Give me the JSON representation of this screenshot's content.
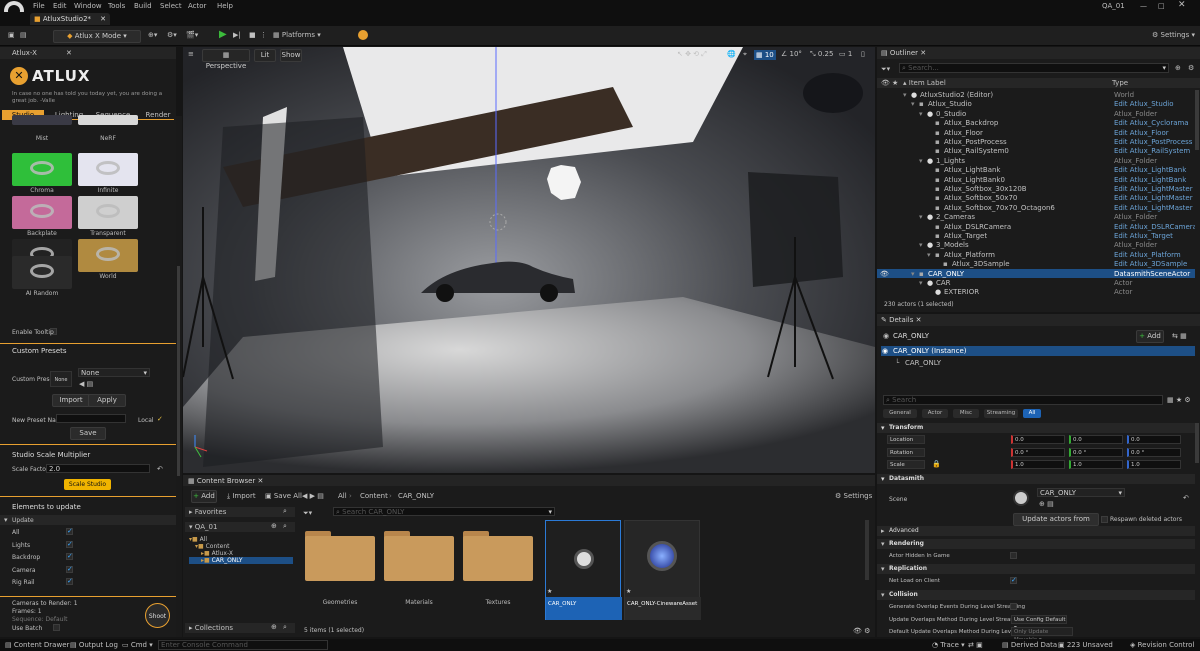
{
  "menu": [
    "File",
    "Edit",
    "Window",
    "Tools",
    "Build",
    "Select",
    "Actor",
    "Help"
  ],
  "project": "QA_01",
  "doc_tab": "AtluxStudio2*",
  "toolbar": {
    "mode": "Atlux X Mode",
    "platforms": "Platforms",
    "settings": "Settings"
  },
  "viewport": {
    "perspective": "Perspective",
    "lit": "Lit",
    "show": "Show",
    "grid": "10",
    "angle": "10°",
    "scale": "0.25",
    "cam": "1"
  },
  "left": {
    "tab": "Atlux-X",
    "logo": "ATLUX",
    "tagline": "In case no one has told you today yet, you are doing a great job. -Valle",
    "tabs": [
      "Studio",
      "Lighting",
      "Sequence",
      "Render"
    ],
    "thumbs": [
      {
        "label": "Mist",
        "color": "#3a3a45"
      },
      {
        "label": "NeRF",
        "color": "#d8d8d8"
      },
      {
        "label": "Chroma",
        "color": "#2fbf3a"
      },
      {
        "label": "Infinite",
        "color": "#e4e4ef"
      },
      {
        "label": "Backplate",
        "color": "#c46a9a"
      },
      {
        "label": "Transparent",
        "color": "#cfcfcf"
      },
      {
        "label": "MetaPortrait",
        "color": "#222"
      },
      {
        "label": "World",
        "color": "#b08a40"
      },
      {
        "label": "AI Random",
        "color": "#2a2a2a"
      }
    ],
    "enable_tooltip": "Enable Tooltip",
    "custom_presets": "Custom Presets",
    "custom_preset": "Custom Preset",
    "none": "None",
    "none2": "None",
    "import": "Import",
    "apply": "Apply",
    "new_preset_name": "New Preset Name",
    "local": "Local",
    "save": "Save",
    "scale_mult": "Studio Scale Multiplier",
    "scale_factor": "Scale Factor",
    "scale_val": "2.0",
    "scale_studio": "Scale Studio",
    "elements": "Elements to update",
    "update": "Update",
    "update_items": [
      "All",
      "Lights",
      "Backdrop",
      "Camera",
      "Rig Rail"
    ],
    "cameras": "Cameras to Render: 1",
    "frames": "Frames: 1",
    "sequence": "Sequence: Default",
    "use_batch": "Use Batch",
    "shoot": "Shoot"
  },
  "outliner": {
    "title": "Outliner",
    "search": "Search...",
    "col_label": "Item Label",
    "col_type": "Type",
    "count": "230 actors (1 selected)",
    "rows": [
      {
        "n": "AtluxStudio2 (Editor)",
        "t": "World",
        "d": 0,
        "g": 1
      },
      {
        "n": "Atlux_Studio",
        "t": "Edit Atlux_Studio",
        "d": 1,
        "g": 0
      },
      {
        "n": "0_Studio",
        "t": "Atlux_Folder",
        "d": 2,
        "g": 1
      },
      {
        "n": "Atlux_Backdrop",
        "t": "Edit Atlux_Cyclorama",
        "d": 3,
        "g": 0
      },
      {
        "n": "Atlux_Floor",
        "t": "Edit Atlux_Floor",
        "d": 3,
        "g": 0
      },
      {
        "n": "Atlux_PostProcess",
        "t": "Edit Atlux_PostProcess",
        "d": 3,
        "g": 0
      },
      {
        "n": "Atlux_RailSystem0",
        "t": "Edit Atlux_RailSystem",
        "d": 3,
        "g": 0
      },
      {
        "n": "1_Lights",
        "t": "Atlux_Folder",
        "d": 2,
        "g": 1
      },
      {
        "n": "Atlux_LightBank",
        "t": "Edit Atlux_LightBank",
        "d": 3,
        "g": 0
      },
      {
        "n": "Atlux_LightBank0",
        "t": "Edit Atlux_LightBank",
        "d": 3,
        "g": 0
      },
      {
        "n": "Atlux_Softbox_30x120B",
        "t": "Edit Atlux_LightMaster",
        "d": 3,
        "g": 0
      },
      {
        "n": "Atlux_Softbox_50x70",
        "t": "Edit Atlux_LightMaster",
        "d": 3,
        "g": 0
      },
      {
        "n": "Atlux_Softbox_70x70_Octagon6",
        "t": "Edit Atlux_LightMaster",
        "d": 3,
        "g": 0
      },
      {
        "n": "2_Cameras",
        "t": "Atlux_Folder",
        "d": 2,
        "g": 1
      },
      {
        "n": "Atlux_DSLRCamera",
        "t": "Edit Atlux_DSLRCamera",
        "d": 3,
        "g": 0
      },
      {
        "n": "Atlux_Target",
        "t": "Edit Atlux_Target",
        "d": 3,
        "g": 0
      },
      {
        "n": "3_Models",
        "t": "Atlux_Folder",
        "d": 2,
        "g": 1
      },
      {
        "n": "Atlux_Platform",
        "t": "Edit Atlux_Platform",
        "d": 3,
        "g": 0
      },
      {
        "n": "Atlux_3DSample",
        "t": "Edit Atlux_3DSample",
        "d": 4,
        "g": 0
      },
      {
        "n": "CAR_ONLY",
        "t": "DatasmithSceneActor",
        "d": 1,
        "g": 0,
        "sel": 1
      },
      {
        "n": "CAR",
        "t": "Actor",
        "d": 2,
        "g": 1
      },
      {
        "n": "EXTERIOR",
        "t": "Actor",
        "d": 3,
        "g": 1
      }
    ]
  },
  "details": {
    "title": "Details",
    "actor": "CAR_ONLY",
    "add": "Add",
    "instance": "CAR_ONLY (Instance)",
    "child": "CAR_ONLY",
    "search": "Search",
    "filters": [
      "General",
      "Actor",
      "Misc",
      "Streaming",
      "All"
    ],
    "transform": "Transform",
    "location": "Location",
    "rotation": "Rotation",
    "scale": "Scale",
    "loc": [
      "0.0",
      "0.0",
      "0.0"
    ],
    "rot": [
      "0.0 °",
      "0.0 °",
      "0.0 °"
    ],
    "scl": [
      "1.0",
      "1.0",
      "1.0"
    ],
    "datasmith": "Datasmith",
    "scene": "Scene",
    "scene_val": "CAR_ONLY",
    "update_actors": "Update actors from Scene",
    "respawn": "Respawn deleted actors",
    "advanced": "Advanced",
    "rendering": "Rendering",
    "hidden": "Actor Hidden In Game",
    "replication": "Replication",
    "netload": "Net Load on Client",
    "collision": "Collision",
    "gen_overlap": "Generate Overlap Events During Level Streaming",
    "upd_overlap": "Update Overlaps Method During Level Streaming",
    "upd_val": "Use Config Default",
    "def_overlap": "Default Update Overlaps Method During Level Str...",
    "def_val": "Only Update Movable"
  },
  "content": {
    "title": "Content Browser",
    "add": "Add",
    "import": "Import",
    "saveall": "Save All",
    "path": [
      "All",
      "Content",
      "CAR_ONLY"
    ],
    "settings": "Settings",
    "favorites": "Favorites",
    "project": "QA_01",
    "tree": [
      "All",
      "Content",
      "Atlux-X",
      "CAR_ONLY"
    ],
    "collections": "Collections",
    "search": "Search CAR_ONLY",
    "assets": [
      "Geometries",
      "Materials",
      "Textures",
      "CAR_ONLY",
      "CAR_ONLY-CinewareAsset"
    ],
    "count": "5 items (1 selected)"
  },
  "status": {
    "drawer": "Content Drawer",
    "output": "Output Log",
    "cmd": "Cmd",
    "console": "Enter Console Command",
    "trace": "Trace",
    "derived": "Derived Data",
    "unsaved": "223 Unsaved",
    "revision": "Revision Control"
  }
}
